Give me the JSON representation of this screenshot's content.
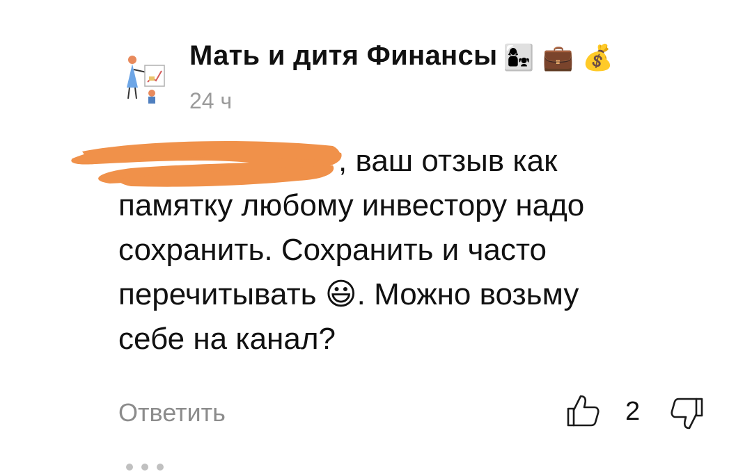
{
  "author": {
    "name": "Мать и дитя Финансы",
    "emoji": "👩‍👧 💼 💰",
    "avatar_icon": "mother-child-finance-avatar"
  },
  "comment": {
    "timestamp": "24 ч",
    "text_line1_visible": ", ваш отзыв как",
    "text_line2": "памятку любому инвестору надо",
    "text_line3": "сохранить. Сохранить и часто",
    "text_line4_before_emoji": "перечитывать ",
    "emoji": "😃",
    "text_line4_after_emoji": ". Можно возьму",
    "text_line5": "себе на канал?"
  },
  "actions": {
    "reply_label": "Ответить",
    "like_count": "2",
    "like_icon": "thumbs-up-icon",
    "dislike_icon": "thumbs-down-icon",
    "more_icon": "more-dots-icon"
  },
  "colors": {
    "redaction": "#f0914a",
    "muted_text": "#8c8c8c",
    "timestamp": "#9a9a9a",
    "text": "#111111"
  }
}
